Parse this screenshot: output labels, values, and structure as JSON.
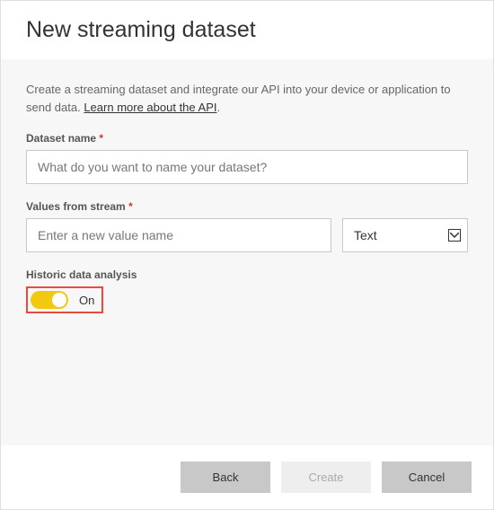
{
  "header": {
    "title": "New streaming dataset"
  },
  "intro": {
    "text_before_link": "Create a streaming dataset and integrate our API into your device or application to send data. ",
    "link_text": "Learn more about the API",
    "text_after_link": "."
  },
  "fields": {
    "dataset_name": {
      "label": "Dataset name",
      "required_mark": "*",
      "placeholder": "What do you want to name your dataset?"
    },
    "values_from_stream": {
      "label": "Values from stream",
      "required_mark": "*",
      "value_placeholder": "Enter a new value name",
      "type_selected": "Text"
    },
    "historic": {
      "label": "Historic data analysis",
      "toggle_state": "On"
    }
  },
  "footer": {
    "back": "Back",
    "create": "Create",
    "cancel": "Cancel"
  }
}
